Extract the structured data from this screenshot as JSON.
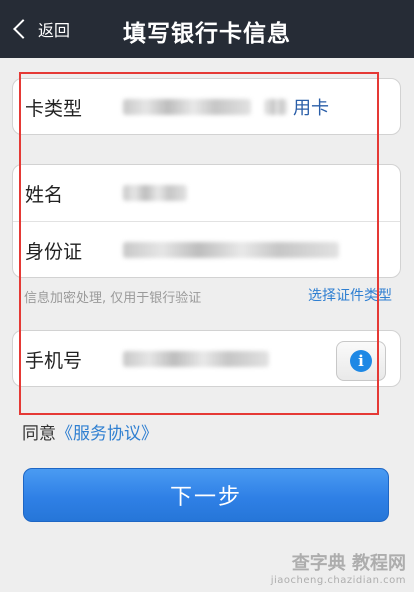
{
  "header": {
    "back_label": "返回",
    "title": "填写银行卡信息"
  },
  "card_type": {
    "label": "卡类型",
    "value_suffix": "用卡"
  },
  "identity": {
    "name_label": "姓名",
    "id_label": "身份证"
  },
  "note": {
    "text": "信息加密处理, 仅用于银行验证",
    "choose_doc": "选择证件类型"
  },
  "phone": {
    "label": "手机号",
    "info_icon": "i"
  },
  "agreement": {
    "prefix": "同意",
    "link": "《服务协议》"
  },
  "next_button": "下一步",
  "watermark": {
    "main": "查字典 教程网",
    "sub": "jiaocheng.chazidian.com"
  },
  "colors": {
    "header_bg": "#262c36",
    "accent": "#2f7fd1",
    "button": "#2f80e6",
    "highlight": "#e53935"
  }
}
